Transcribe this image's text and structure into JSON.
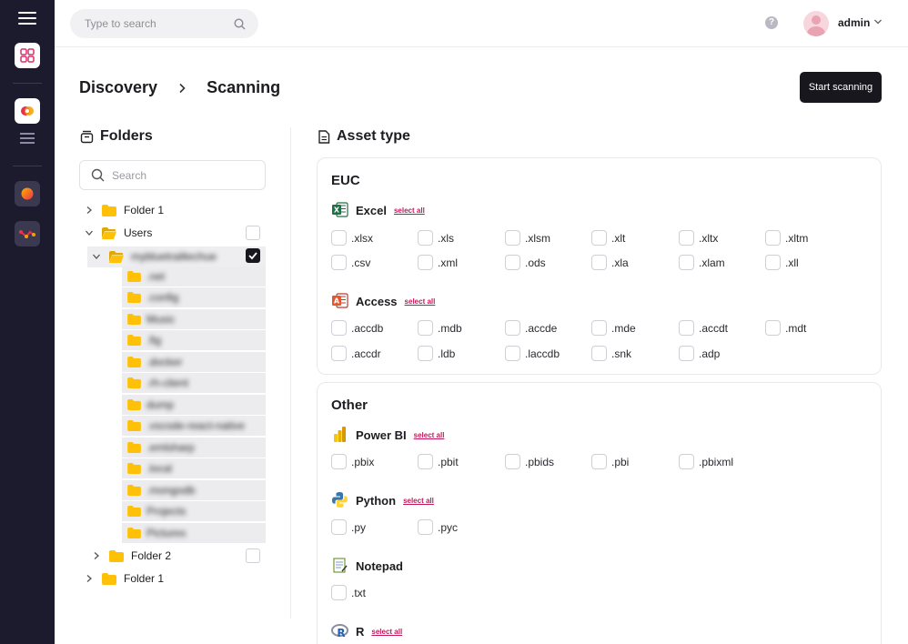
{
  "topbar": {
    "search_placeholder": "Type to search",
    "help_label": "?",
    "user_name": "admin"
  },
  "breadcrumb": {
    "parent": "Discovery",
    "current": "Scanning"
  },
  "actions": {
    "start_label": "Start scanning"
  },
  "folders": {
    "title": "Folders",
    "search_placeholder": "Search",
    "tree": {
      "folder1": "Folder 1",
      "users": "Users",
      "user_home": "mybluetrailtechue",
      "subfolders": [
        ".net",
        ".config",
        "Music",
        ".fig",
        ".docker",
        ".rh-client",
        "dump",
        ".vscode-react-native",
        ".emlsharp",
        ".local",
        ".mongodb",
        "Projects",
        "Pictures"
      ],
      "folder2": "Folder 2",
      "folder1b": "Folder 1"
    }
  },
  "asset": {
    "title": "Asset type",
    "select_all": "select all",
    "euc": {
      "title": "EUC",
      "excel": {
        "name": "Excel",
        "exts": [
          ".xlsx",
          ".xls",
          ".xlsm",
          ".xlt",
          ".xltx",
          ".xltm",
          ".csv",
          ".xml",
          ".ods",
          ".xla",
          ".xlam",
          ".xll"
        ]
      },
      "access": {
        "name": "Access",
        "exts": [
          ".accdb",
          ".mdb",
          ".accde",
          ".mde",
          ".accdt",
          ".mdt",
          ".accdr",
          ".ldb",
          ".laccdb",
          ".snk",
          ".adp"
        ]
      }
    },
    "other": {
      "title": "Other",
      "powerbi": {
        "name": "Power BI",
        "exts": [
          ".pbix",
          ".pbit",
          ".pbids",
          ".pbi",
          ".pbixml"
        ]
      },
      "python": {
        "name": "Python",
        "exts": [
          ".py",
          ".pyc"
        ]
      },
      "notepad": {
        "name": "Notepad",
        "exts": [
          ".txt"
        ]
      },
      "r": {
        "name": "R"
      }
    }
  },
  "colors": {
    "sidebar": "#1c1b2e",
    "accent_link": "#c2185b",
    "primary_button": "#17171d",
    "folder": "#ffc107"
  }
}
